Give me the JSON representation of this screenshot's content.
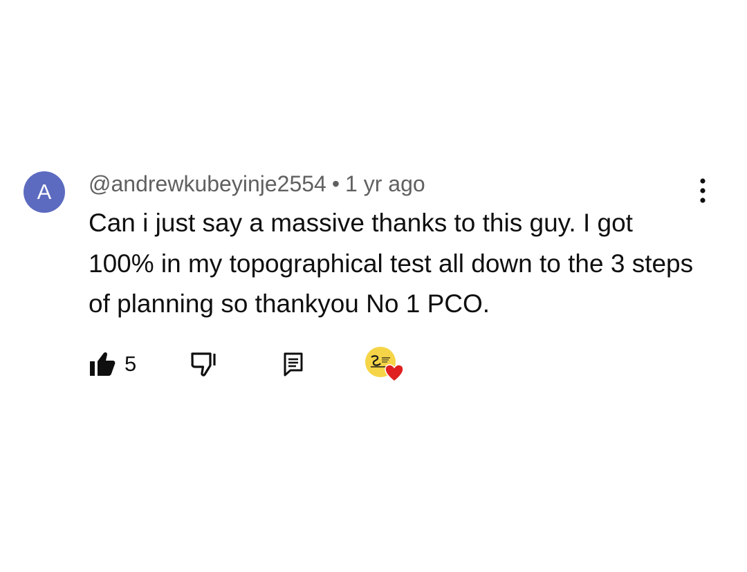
{
  "comment": {
    "avatar_letter": "A",
    "author_handle": "@andrewkubeyinje2554",
    "separator": "•",
    "timestamp": "1 yr ago",
    "text": "Can i just say a massive thanks to this guy. I got 100% in my topographical test all down to the 3 steps of planning so thankyou No 1 PCO.",
    "like_count": "5",
    "creator_heart": true,
    "icons": {
      "like": "thumb-up-filled-icon",
      "dislike": "thumb-down-icon",
      "reply": "reply-comment-icon",
      "more": "more-vertical-icon",
      "heart": "heart-icon"
    }
  },
  "colors": {
    "avatar_bg": "#5c6bc0",
    "meta_text": "#606060",
    "body_text": "#0f0f0f",
    "heart": "#e02020",
    "creator_avatar_bg": "#f5d547"
  }
}
